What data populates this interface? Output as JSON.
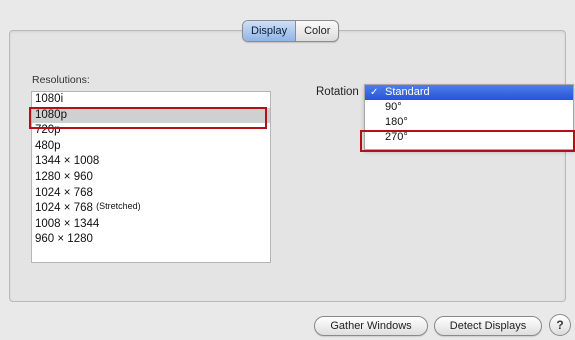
{
  "tabs": [
    {
      "label": "Display",
      "selected": true
    },
    {
      "label": "Color",
      "selected": false
    }
  ],
  "resolutions": {
    "label": "Resolutions:",
    "items": [
      {
        "text": "1080i"
      },
      {
        "text": "1080p",
        "selected": true
      },
      {
        "text": "720p"
      },
      {
        "text": "480p"
      },
      {
        "text": "1344 × 1008"
      },
      {
        "text": "1280 × 960"
      },
      {
        "text": "1024 × 768"
      },
      {
        "text": "1024 × 768",
        "suffix": "(Stretched)"
      },
      {
        "text": "1008 × 1344"
      },
      {
        "text": "960 × 1280"
      }
    ]
  },
  "rotation": {
    "label": "Rotation",
    "checkmark": "✓",
    "options": [
      {
        "text": "Standard",
        "selected": true
      },
      {
        "text": "90°"
      },
      {
        "text": "180°"
      },
      {
        "text": "270°"
      }
    ]
  },
  "buttons": {
    "gather": "Gather Windows",
    "detect": "Detect Displays",
    "help": "?"
  },
  "colors": {
    "highlight_box": "#b3111a",
    "menu_selection": "#2f5fe0"
  }
}
